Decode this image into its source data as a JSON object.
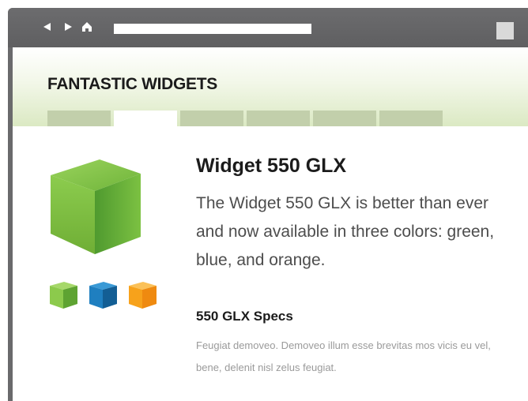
{
  "browser": {
    "back_icon": "back-arrow-icon",
    "forward_icon": "forward-arrow-icon",
    "home_icon": "home-icon",
    "address_value": "",
    "window_button_icon": "window-button-icon",
    "chrome_color": "#666668"
  },
  "header": {
    "site_title": "FANTASTIC WIDGETS",
    "tabs": [
      {
        "label": "",
        "active": false
      },
      {
        "label": "",
        "active": true
      },
      {
        "label": "",
        "active": false
      },
      {
        "label": "",
        "active": false
      },
      {
        "label": "",
        "active": false
      },
      {
        "label": "",
        "active": false
      }
    ],
    "accent_color": "#c2cfab"
  },
  "product": {
    "title": "Widget 550 GLX",
    "description": "The Widget 550 GLX is better than ever and now available in three colors: green, blue, and orange.",
    "hero_icon": "green-cube-icon",
    "swatches": [
      {
        "icon": "green-cube-icon",
        "color": "#7cc142"
      },
      {
        "icon": "blue-cube-icon",
        "color": "#1f7fc0"
      },
      {
        "icon": "orange-cube-icon",
        "color": "#f7a21b"
      }
    ]
  },
  "specs": {
    "heading": "550 GLX Specs",
    "body": "Feugiat demoveo. Demoveo illum esse brevitas mos vicis eu vel, bene, delenit nisl zelus feugiat."
  }
}
